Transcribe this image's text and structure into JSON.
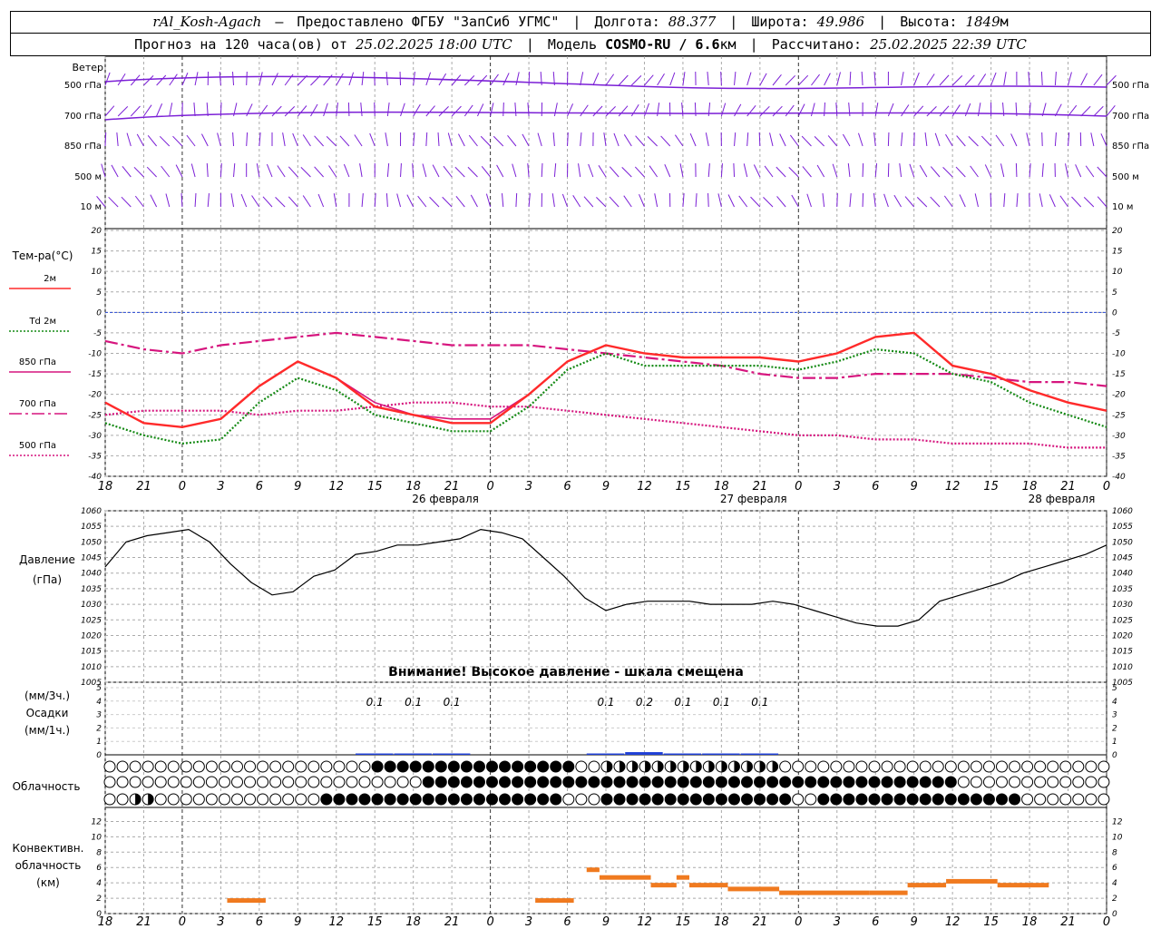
{
  "header": {
    "station": "rAl_Kosh-Agach",
    "provider": "Предоставлено ФГБУ \"ЗапСиб УГМС\"",
    "lon_label": "Долгота:",
    "lon": "88.377",
    "lat_label": "Широта:",
    "lat": "49.986",
    "alt_label": "Высота:",
    "alt": "1849",
    "alt_unit": "м",
    "forecast_prefix": "Прогноз на 120 часа(ов) от",
    "forecast_start": "25.02.2025 18:00 UTC",
    "model_label": "Модель",
    "model": "COSMO-RU / 6.6",
    "model_unit": "км",
    "computed_label": "Рассчитано:",
    "computed": "25.02.2025 22:39 UTC"
  },
  "wind": {
    "title": "Ветер",
    "levels": [
      "500 гПа",
      "700 гПа",
      "850 гПа",
      "500 м",
      "10 м"
    ],
    "colors": {
      "barb": "#7b1fd6"
    }
  },
  "temperature": {
    "title": "Тем-ра(°C)",
    "legend": [
      {
        "label": "2м",
        "color": "#ff2a2a",
        "style": "solid"
      },
      {
        "label": "Td 2м",
        "color": "#148a14",
        "style": "dotted"
      },
      {
        "label": "850 гПа",
        "color": "#d6157e",
        "style": "solid"
      },
      {
        "label": "700 гПа",
        "color": "#d6157e",
        "style": "dashdot"
      },
      {
        "label": "500 гПа",
        "color": "#d6157e",
        "style": "dotted"
      }
    ],
    "yticks": [
      20,
      15,
      10,
      5,
      0,
      -5,
      -10,
      -15,
      -20,
      -25,
      -30,
      -35,
      -40
    ]
  },
  "time_axis": {
    "hour_labels": [
      "18",
      "21",
      "0",
      "3",
      "6",
      "9",
      "12",
      "15",
      "18",
      "21",
      "0",
      "3",
      "6",
      "9",
      "12",
      "15",
      "18",
      "21",
      "0",
      "3",
      "6",
      "9",
      "12",
      "15",
      "18",
      "21",
      "0"
    ],
    "dates": [
      "26 февраля",
      "27 февраля",
      "28 февраля"
    ]
  },
  "pressure": {
    "title": "Давление",
    "unit": "(гПа)",
    "yticks": [
      1060,
      1055,
      1050,
      1045,
      1040,
      1035,
      1030,
      1025,
      1020,
      1015,
      1010,
      1005
    ],
    "warning": "Внимание! Высокое давление - шкала смещена"
  },
  "precip": {
    "title_1": "(мм/3ч.)",
    "title_2": "Осадки",
    "title_3": "(мм/1ч.)",
    "yticks": [
      5,
      4,
      3,
      2,
      1,
      0
    ],
    "values": [
      {
        "hour": 21,
        "label": "0.1"
      },
      {
        "hour": 24,
        "label": "0.1"
      },
      {
        "hour": 27,
        "label": "0.1"
      },
      {
        "hour": 39,
        "label": "0.1"
      },
      {
        "hour": 42,
        "label": "0.2"
      },
      {
        "hour": 45,
        "label": "0.1"
      },
      {
        "hour": 48,
        "label": "0.1"
      },
      {
        "hour": 51,
        "label": "0.1"
      }
    ]
  },
  "cloud": {
    "title": "Облачность"
  },
  "convective": {
    "title_1": "Конвективн.",
    "title_2": "облачность",
    "title_3": "(км)",
    "yticks": [
      12,
      10,
      8,
      6,
      4,
      2,
      0
    ]
  },
  "chart_data": [
    {
      "type": "line",
      "title": "Тем-ра(°C)",
      "x_unit": "hours from 25.02.2025 18:00 UTC",
      "ylim": [
        -40,
        20
      ],
      "x": [
        0,
        3,
        6,
        9,
        12,
        15,
        18,
        21,
        24,
        27,
        30,
        33,
        36,
        39,
        42,
        45,
        48,
        51,
        54,
        57,
        60,
        63,
        66,
        69,
        72,
        75,
        78
      ],
      "series": [
        {
          "name": "2м",
          "values": [
            -22,
            -27,
            -28,
            -26,
            -18,
            -12,
            -16,
            -23,
            -25,
            -27,
            -27,
            -20,
            -12,
            -8,
            -10,
            -11,
            -11,
            -11,
            -12,
            -10,
            -6,
            -5,
            -13,
            -15,
            -19,
            -22,
            -24
          ]
        },
        {
          "name": "Td 2м",
          "values": [
            -27,
            -30,
            -32,
            -31,
            -22,
            -16,
            -19,
            -25,
            -27,
            -29,
            -29,
            -23,
            -14,
            -10,
            -13,
            -13,
            -13,
            -13,
            -14,
            -12,
            -9,
            -10,
            -15,
            -17,
            -22,
            -25,
            -28
          ]
        },
        {
          "name": "850 гПа",
          "values": [
            -22,
            -27,
            -28,
            -26,
            -18,
            -12,
            -16,
            -22,
            -25,
            -26,
            -26,
            -20,
            -12,
            -8,
            -10,
            -11,
            -11,
            -11,
            -12,
            -10,
            -6,
            -5,
            -13,
            -15,
            -19,
            -22,
            -24
          ]
        },
        {
          "name": "700 гПа",
          "values": [
            -7,
            -9,
            -10,
            -8,
            -7,
            -6,
            -5,
            -6,
            -7,
            -8,
            -8,
            -8,
            -9,
            -10,
            -11,
            -12,
            -13,
            -15,
            -16,
            -16,
            -15,
            -15,
            -15,
            -16,
            -17,
            -17,
            -18
          ]
        },
        {
          "name": "500 гПа",
          "values": [
            -25,
            -24,
            -24,
            -24,
            -25,
            -24,
            -24,
            -23,
            -22,
            -22,
            -23,
            -23,
            -24,
            -25,
            -26,
            -27,
            -28,
            -29,
            -30,
            -30,
            -31,
            -31,
            -32,
            -32,
            -32,
            -33,
            -33
          ]
        }
      ]
    },
    {
      "type": "line",
      "title": "Давление",
      "ylabel": "(гПа)",
      "ylim": [
        1005,
        1060
      ],
      "x": [
        0,
        2,
        4,
        6,
        8,
        10,
        12,
        14,
        16,
        18,
        20,
        22,
        24,
        26,
        28,
        30,
        32,
        34,
        36,
        38,
        40,
        42,
        44,
        46,
        48,
        50,
        52,
        54,
        56,
        58,
        60,
        62,
        64,
        66,
        68,
        70,
        72,
        74,
        76,
        78
      ],
      "series": [
        {
          "name": "",
          "values": [
            1042,
            1050,
            1052,
            1053,
            1054,
            1050,
            1043,
            1037,
            1033,
            1034,
            1039,
            1041,
            1046,
            1047,
            1049,
            1049,
            1050,
            1051,
            1054,
            1053,
            1051,
            1045,
            1039,
            1032,
            1028,
            1030,
            1031,
            1031,
            1031,
            1030,
            1030,
            1030,
            1031,
            1030,
            1028,
            1026,
            1024,
            1023,
            1023,
            1025,
            1031,
            1033,
            1035,
            1037,
            1040,
            1042,
            1044,
            1046,
            1049
          ]
        }
      ]
    },
    {
      "type": "bar",
      "title": "Осадки",
      "ylabel": "(мм/3ч.)",
      "categories": [
        "21",
        "0",
        "3",
        "12",
        "15",
        "18",
        "21",
        "0"
      ],
      "values": [
        0.1,
        0.1,
        0.1,
        0.1,
        0.2,
        0.1,
        0.1,
        0.1
      ],
      "ylim": [
        0,
        5
      ]
    },
    {
      "type": "bar",
      "title": "Конвективн. облачность",
      "ylabel": "(км)",
      "ylim": [
        0,
        13
      ],
      "segments": [
        {
          "from_hour": 9.5,
          "to_hour": 12.5,
          "top_km": 2
        },
        {
          "from_hour": 33.5,
          "to_hour": 36.5,
          "top_km": 2
        },
        {
          "from_hour": 37.5,
          "to_hour": 38.5,
          "top_km": 6
        },
        {
          "from_hour": 38.5,
          "to_hour": 42.5,
          "top_km": 5
        },
        {
          "from_hour": 42.5,
          "to_hour": 44.5,
          "top_km": 4
        },
        {
          "from_hour": 44.5,
          "to_hour": 45.5,
          "top_km": 5
        },
        {
          "from_hour": 45.5,
          "to_hour": 48.5,
          "top_km": 4
        },
        {
          "from_hour": 48.5,
          "to_hour": 52.5,
          "top_km": 3.5
        },
        {
          "from_hour": 52.5,
          "to_hour": 59.5,
          "top_km": 3
        },
        {
          "from_hour": 59.5,
          "to_hour": 62.5,
          "top_km": 3
        },
        {
          "from_hour": 62.5,
          "to_hour": 65.5,
          "top_km": 4
        },
        {
          "from_hour": 65.5,
          "to_hour": 69.5,
          "top_km": 4.5
        },
        {
          "from_hour": 69.5,
          "to_hour": 73.5,
          "top_km": 4
        }
      ]
    }
  ]
}
